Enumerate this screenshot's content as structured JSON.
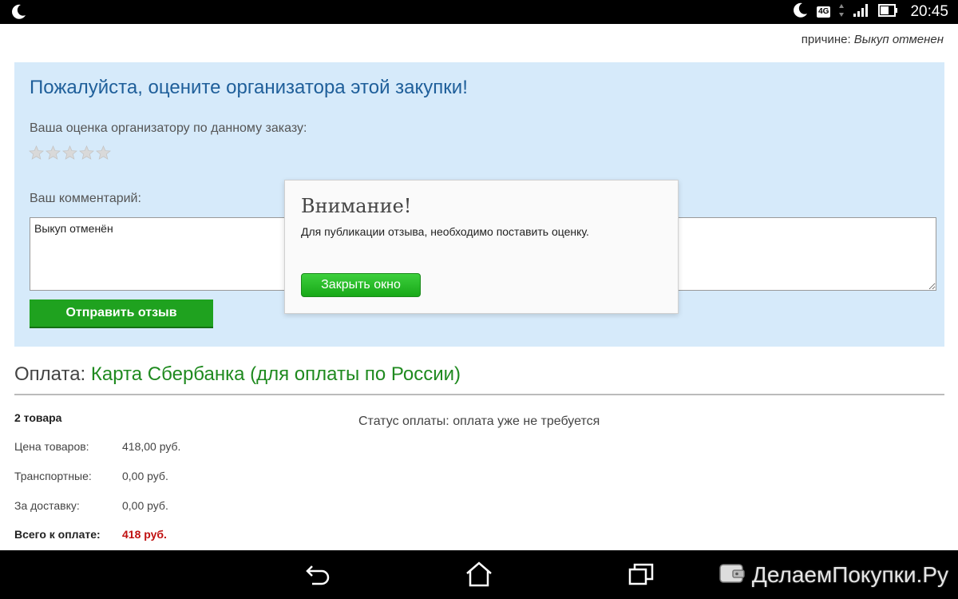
{
  "statusbar": {
    "time": "20:45",
    "network": "4G"
  },
  "page": {
    "reason_label": "причине:",
    "reason_value": "Выкуп отменен"
  },
  "rating_panel": {
    "title": "Пожалуйста, оцените организатора этой закупки!",
    "rating_label": "Ваша оценка организатору по данному заказу:",
    "stars_total": 5,
    "stars_selected": 0,
    "comment_label": "Ваш комментарий:",
    "comment_value": "Выкуп отменён",
    "submit_label": "Отправить отзыв"
  },
  "payment": {
    "title_prefix": "Оплата:",
    "method": "Карта Сбербанка (для оплаты по России)",
    "items_count": "2 товара",
    "rows": [
      {
        "label": "Цена товаров:",
        "value": "418,00 руб."
      },
      {
        "label": "Транспортные:",
        "value": "0,00 руб."
      },
      {
        "label": "За доставку:",
        "value": "0,00 руб."
      }
    ],
    "total_label": "Всего к оплате:",
    "total_value": "418 руб.",
    "status": "Статус оплаты: оплата уже не требуется"
  },
  "modal": {
    "title": "Внимание!",
    "text": "Для публикации отзыва, необходимо поставить оценку.",
    "close_label": "Закрыть окно"
  },
  "navbar": {
    "watermark": "ДелаемПокупки.Ру"
  },
  "colors": {
    "panel_bg": "#d6eafa",
    "title_blue": "#1f5f9a",
    "accent_green": "#1fa21f",
    "total_red": "#c01010"
  }
}
